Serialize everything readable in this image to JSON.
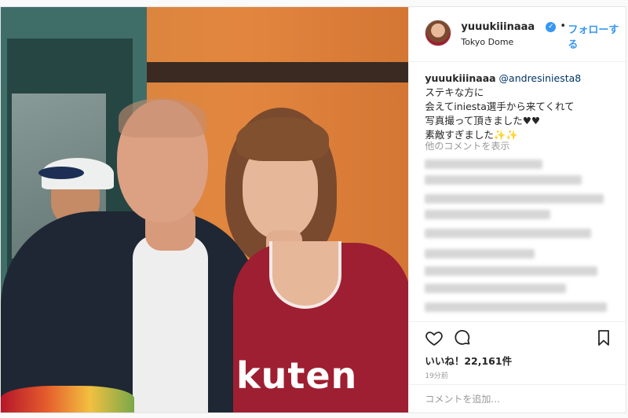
{
  "post": {
    "username": "yuuukiiinaaa",
    "verified_icon": "verified-badge-icon",
    "separator": "•",
    "follow_label": "フォローする",
    "location": "Tokyo Dome",
    "photo": {
      "jersey_text": "kuten"
    },
    "caption": {
      "user": "yuuukiiinaaa",
      "mention": "@andresiniesta8",
      "lines": [
        "ステキな方に",
        "会えてiniesta選手から来てくれて",
        "写真撮って頂きました♥♥",
        "素敵すぎました✨✨"
      ]
    },
    "more_comments": "他のコメントを表示",
    "likes_label": "いいね！22,161件",
    "time": "19分前",
    "comment_placeholder": "コメントを追加...",
    "icons": {
      "like": "heart-icon",
      "comment": "comment-icon",
      "save": "bookmark-icon"
    },
    "colors": {
      "accent": "#3897f0",
      "text": "#262626",
      "muted": "#999999",
      "jersey": "#9e1f31"
    }
  }
}
